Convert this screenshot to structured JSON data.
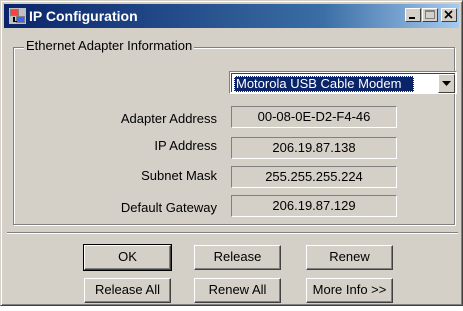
{
  "window": {
    "title": "IP Configuration",
    "controls": {
      "minimize_icon": "minimize-icon",
      "maximize_icon": "maximize-icon",
      "close_icon": "close-icon"
    },
    "colors": {
      "titlebar_start": "#0a246a",
      "titlebar_end": "#a6caf0",
      "face": "#d4d0c8",
      "selection": "#0a246a"
    }
  },
  "adapter_info": {
    "group_label": "Ethernet  Adapter Information",
    "adapter_select": {
      "selected": "Motorola USB Cable Modem"
    },
    "fields": {
      "adapter_address": {
        "label": "Adapter Address",
        "value": "00-08-0E-D2-F4-46"
      },
      "ip_address": {
        "label": "IP Address",
        "value": "206.19.87.138"
      },
      "subnet_mask": {
        "label": "Subnet Mask",
        "value": "255.255.255.224"
      },
      "default_gateway": {
        "label": "Default Gateway",
        "value": "206.19.87.129"
      }
    }
  },
  "buttons": {
    "ok": "OK",
    "release": "Release",
    "renew": "Renew",
    "release_all": "Release All",
    "renew_all": "Renew All",
    "more_info": "More Info >>"
  }
}
